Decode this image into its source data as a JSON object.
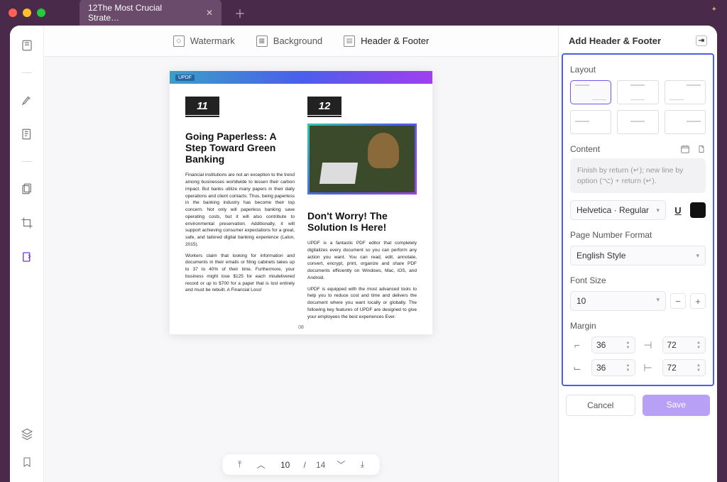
{
  "tab": {
    "title": "12The Most Crucial Strate…"
  },
  "topbar": {
    "watermark": "Watermark",
    "background": "Background",
    "headerfooter": "Header & Footer"
  },
  "doc": {
    "logo": "UPDF",
    "col1": {
      "num": "11",
      "title": "Going Paperless: A Step Toward Green Banking",
      "p1": "Financial institutions are not an exception to the trend among businesses worldwide to lessen their carbon impact. But banks utilize many papers in their daily operations and client contacts. Thus, being paperless in the banking industry has become their top concern. Not only will paperless banking save operating costs, but it will also contribute to environmental preservation. Additionally, it will support achieving consumer expectations for a great, safe, and tailored digital banking experience (Lalon, 2015).",
      "p2": "Workers claim that looking for information and documents in their emails or filing cabinets takes up to 37 to 40% of their time. Furthermore, your business might lose $125 for each misdelivered record or up to $700 for a paper that is lost entirely and must be rebuilt. A Financial Loss!"
    },
    "col2": {
      "num": "12",
      "title": "Don't Worry! The Solution Is Here!",
      "p1": "UPDF is a fantastic PDF editor that completely digitalizes every document so you can perform any action you want. You can read, edit, annotate, convert, encrypt, print, organize and share PDF documents efficiently on Windows, Mac, iOS, and Android.",
      "p2": "UPDF is equipped with the most advanced tools to help you to reduce cost and time and delivers the document where you want locally or globally. The following key features of UPDF are designed to give your employees the best experiences Ever."
    },
    "pagenum": "08"
  },
  "pager": {
    "current": "10",
    "total": "14",
    "sep": "/"
  },
  "panel": {
    "title": "Add Header & Footer",
    "layout_label": "Layout",
    "content_label": "Content",
    "content_placeholder": "Finish by return (↵); new line by option (⌥) + return (↵).",
    "font": "Helvetica · Regular",
    "pnf_label": "Page Number Format",
    "pnf_value": "English Style",
    "fontsize_label": "Font Size",
    "fontsize_value": "10",
    "margin_label": "Margin",
    "margin_top": "36",
    "margin_right": "72",
    "margin_bottom": "36",
    "margin_left": "72",
    "cancel": "Cancel",
    "save": "Save"
  }
}
